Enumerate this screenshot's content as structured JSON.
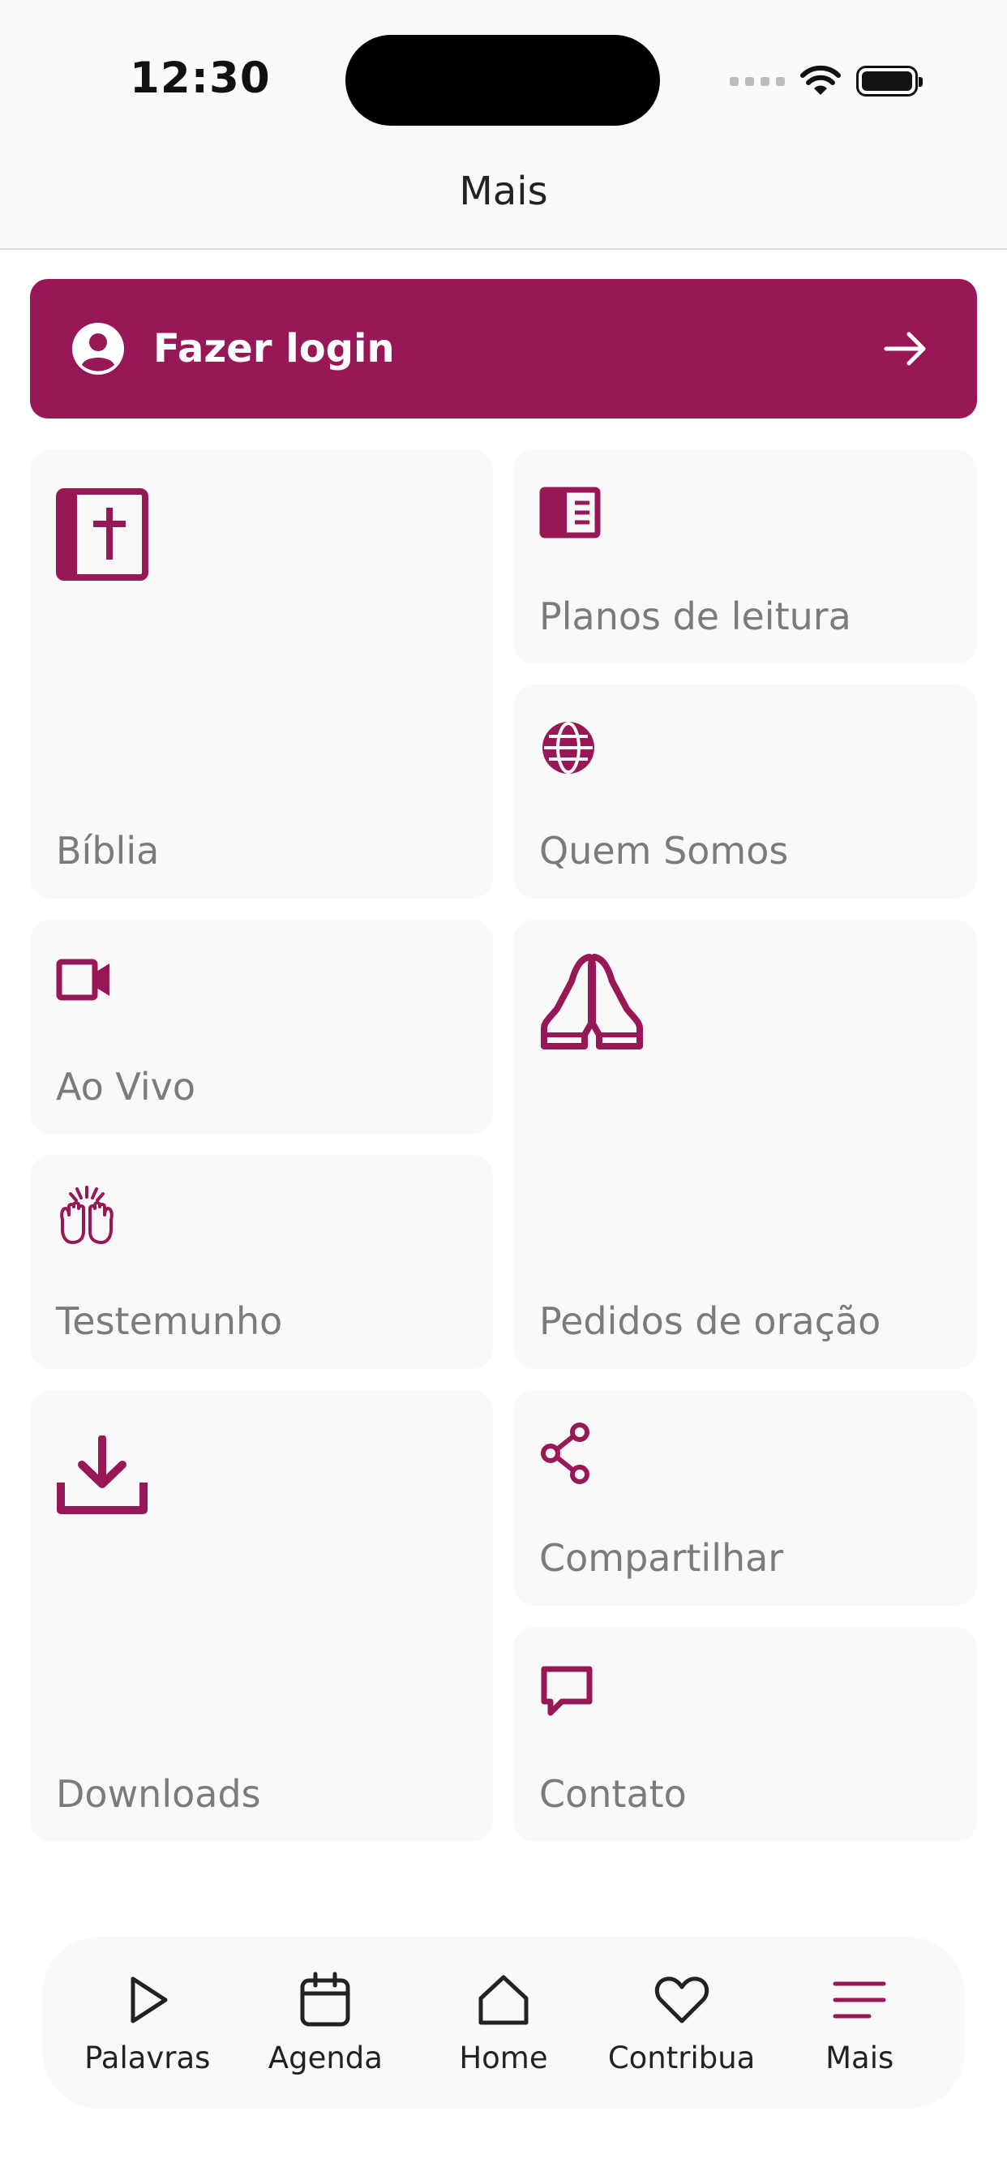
{
  "status_bar": {
    "time": "12:30"
  },
  "header": {
    "title": "Mais"
  },
  "login": {
    "label": "Fazer login"
  },
  "tiles": {
    "biblia": "Bíblia",
    "planos": "Planos de leitura",
    "quem_somos": "Quem Somos",
    "ao_vivo": "Ao Vivo",
    "pedidos": "Pedidos de oração",
    "testemunho": "Testemunho",
    "downloads": "Downloads",
    "compartilhar": "Compartilhar",
    "contato": "Contato"
  },
  "tabbar": {
    "items": [
      {
        "label": "Palavras",
        "icon": "play-icon"
      },
      {
        "label": "Agenda",
        "icon": "calendar-icon"
      },
      {
        "label": "Home",
        "icon": "home-icon"
      },
      {
        "label": "Contribua",
        "icon": "heart-icon"
      },
      {
        "label": "Mais",
        "icon": "menu-icon"
      }
    ],
    "active_index": 4
  },
  "colors": {
    "accent": "#981857",
    "tile_bg": "#f9f9f9",
    "tile_text": "#7b7b7b"
  }
}
